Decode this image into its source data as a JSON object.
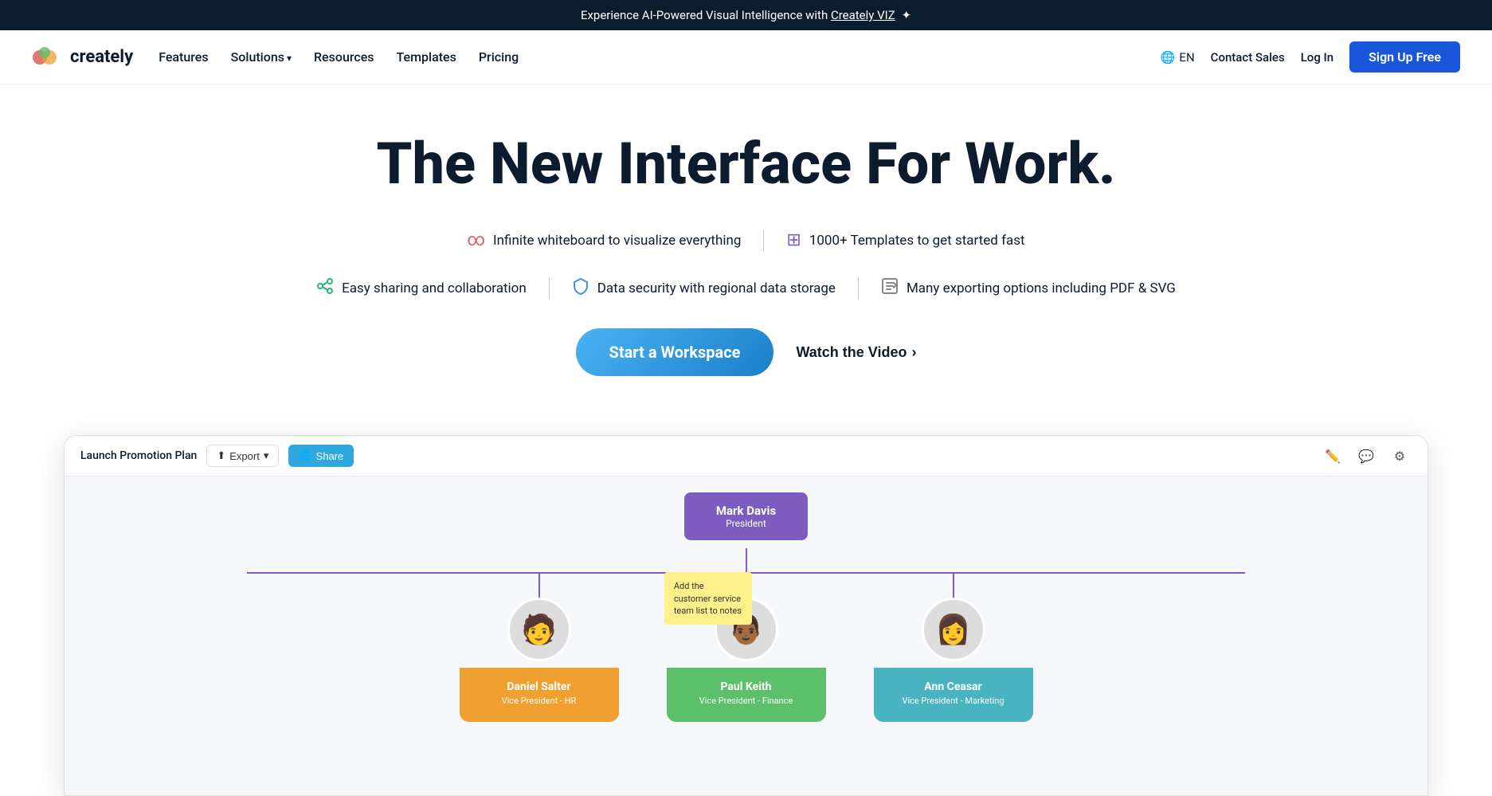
{
  "banner": {
    "text": "Experience AI-Powered Visual Intelligence with",
    "link_text": "Creately VIZ",
    "sparkle": "✦"
  },
  "nav": {
    "logo_text": "creately",
    "links": [
      {
        "label": "Features",
        "has_arrow": false
      },
      {
        "label": "Solutions",
        "has_arrow": true
      },
      {
        "label": "Resources",
        "has_arrow": false
      },
      {
        "label": "Templates",
        "has_arrow": false
      },
      {
        "label": "Pricing",
        "has_arrow": false
      }
    ],
    "lang": "EN",
    "contact_sales": "Contact Sales",
    "login": "Log In",
    "signup": "Sign Up Free"
  },
  "hero": {
    "headline": "The New Interface For Work.",
    "features": [
      {
        "icon": "∞",
        "icon_class": "icon-infinite",
        "text": "Infinite whiteboard to visualize everything"
      },
      {
        "icon": "⊞",
        "icon_class": "icon-templates",
        "text": "1000+ Templates to get started fast"
      },
      {
        "icon": "⋈",
        "icon_class": "icon-sharing",
        "text": "Easy sharing and collaboration"
      },
      {
        "icon": "⊕",
        "icon_class": "icon-security",
        "text": "Data security with regional data storage"
      },
      {
        "icon": "↗",
        "icon_class": "icon-export",
        "text": "Many exporting options including PDF & SVG"
      }
    ],
    "cta_primary": "Start a Workspace",
    "cta_secondary": "Watch the Video",
    "cta_arrow": "›"
  },
  "workspace": {
    "title": "Launch Promotion Plan",
    "export_btn": "Export",
    "share_btn": "Share",
    "org_top": {
      "name": "Mark Davis",
      "role": "President"
    },
    "children": [
      {
        "name": "Daniel Salter",
        "role": "Vice President - HR",
        "color": "card-orange",
        "avatar": "👨"
      },
      {
        "name": "Paul Keith",
        "role": "Vice President - Finance",
        "color": "card-green",
        "avatar": "👨🏾"
      },
      {
        "name": "Ann Ceasar",
        "role": "Vice President - Marketing",
        "color": "card-teal",
        "avatar": "👩"
      }
    ],
    "sticky_note": "Add the customer service team list to notes"
  }
}
